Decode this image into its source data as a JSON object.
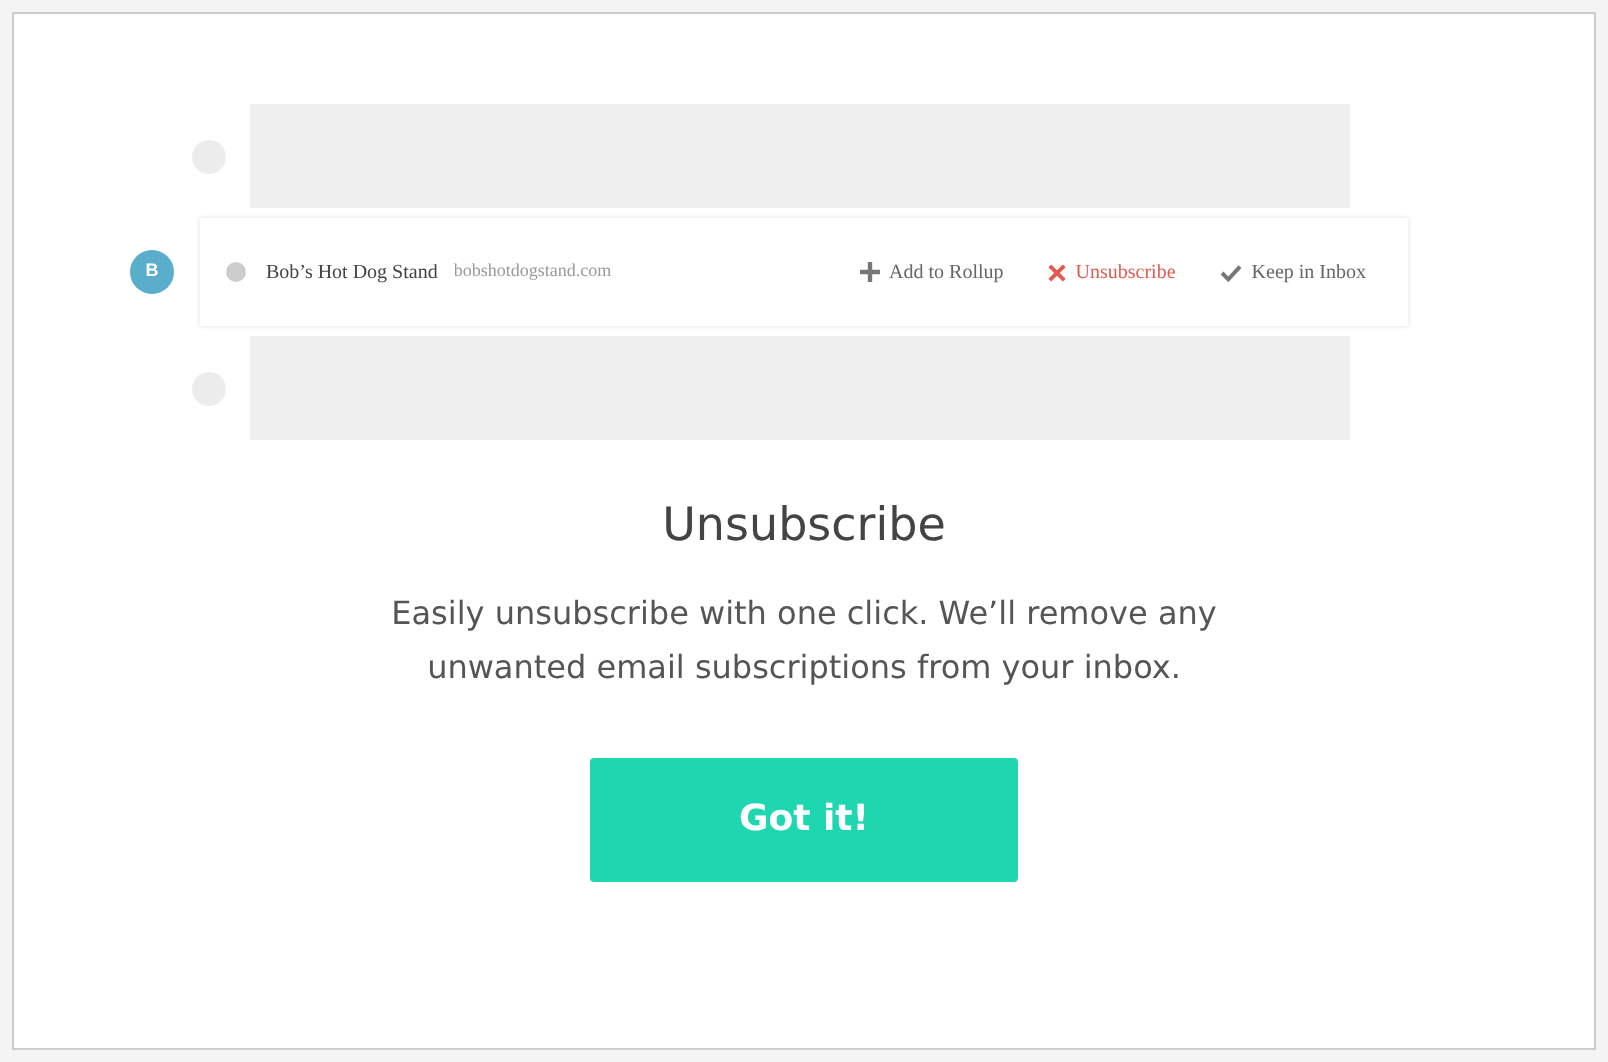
{
  "row": {
    "badge": "B",
    "sender": "Bob’s Hot Dog Stand",
    "domain": "bobshotdogstand.com",
    "actions": [
      {
        "kind": "add",
        "label": "Add to Rollup"
      },
      {
        "kind": "unsubscribe",
        "label": "Unsubscribe"
      },
      {
        "kind": "keep",
        "label": "Keep in Inbox"
      }
    ]
  },
  "title": "Unsubscribe",
  "description": "Easily unsubscribe with one click. We’ll remove any unwanted email subscriptions from your inbox.",
  "button": "Got it!"
}
